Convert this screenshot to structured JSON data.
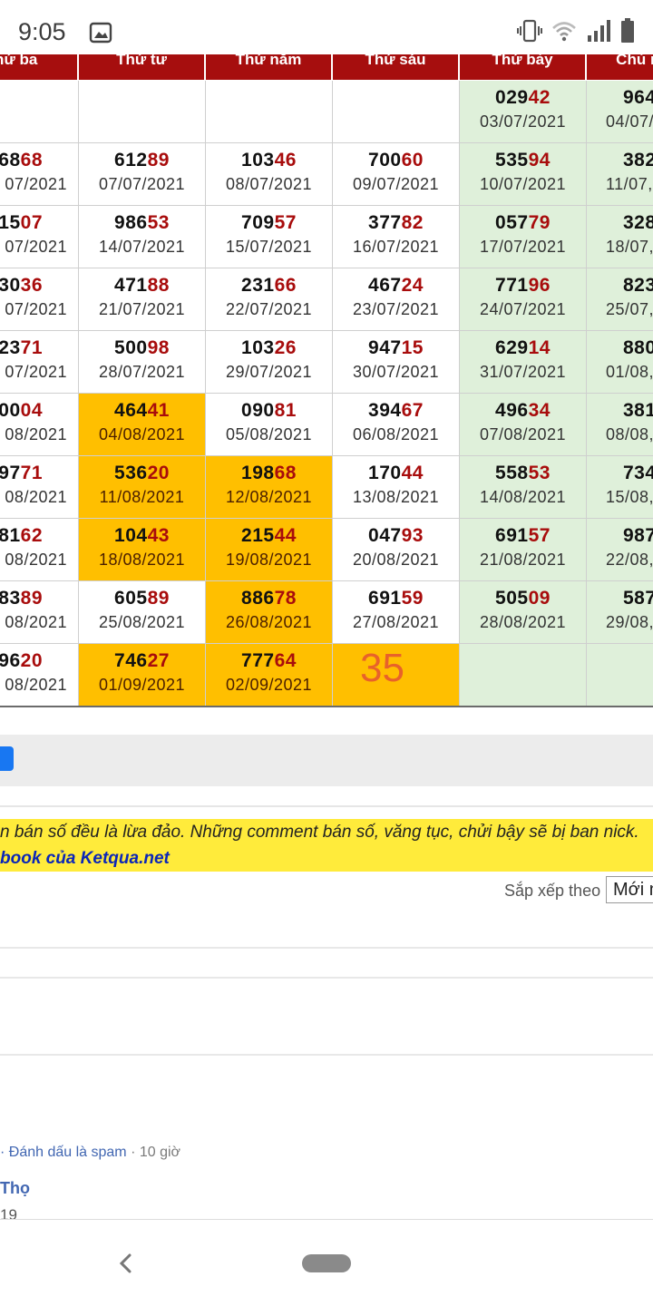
{
  "status": {
    "time": "9:05"
  },
  "table": {
    "headers": [
      "Thứ ba",
      "Thứ tư",
      "Thứ năm",
      "Thứ sáu",
      "Thứ bảy",
      "Chủ nhật"
    ],
    "rows": [
      [
        {
          "head": "",
          "tail": "",
          "date": ""
        },
        {
          "head": "",
          "tail": "",
          "date": ""
        },
        {
          "head": "",
          "tail": "",
          "date": ""
        },
        {
          "head": "",
          "tail": "",
          "date": ""
        },
        {
          "head": "029",
          "tail": "42",
          "date": "03/07/2021"
        },
        {
          "head": "964",
          "tail": "",
          "date": "04/07/"
        }
      ],
      [
        {
          "head": "68",
          "tail": "68",
          "date": "07/2021"
        },
        {
          "head": "612",
          "tail": "89",
          "date": "07/07/2021"
        },
        {
          "head": "103",
          "tail": "46",
          "date": "08/07/2021"
        },
        {
          "head": "700",
          "tail": "60",
          "date": "09/07/2021"
        },
        {
          "head": "535",
          "tail": "94",
          "date": "10/07/2021"
        },
        {
          "head": "382",
          "tail": "",
          "date": "11/07,"
        }
      ],
      [
        {
          "head": "15",
          "tail": "07",
          "date": "07/2021"
        },
        {
          "head": "986",
          "tail": "53",
          "date": "14/07/2021"
        },
        {
          "head": "709",
          "tail": "57",
          "date": "15/07/2021"
        },
        {
          "head": "377",
          "tail": "82",
          "date": "16/07/2021"
        },
        {
          "head": "057",
          "tail": "79",
          "date": "17/07/2021"
        },
        {
          "head": "328",
          "tail": "",
          "date": "18/07,"
        }
      ],
      [
        {
          "head": "30",
          "tail": "36",
          "date": "07/2021"
        },
        {
          "head": "471",
          "tail": "88",
          "date": "21/07/2021"
        },
        {
          "head": "231",
          "tail": "66",
          "date": "22/07/2021"
        },
        {
          "head": "467",
          "tail": "24",
          "date": "23/07/2021"
        },
        {
          "head": "771",
          "tail": "96",
          "date": "24/07/2021"
        },
        {
          "head": "823",
          "tail": "",
          "date": "25/07,"
        }
      ],
      [
        {
          "head": "23",
          "tail": "71",
          "date": "07/2021"
        },
        {
          "head": "500",
          "tail": "98",
          "date": "28/07/2021"
        },
        {
          "head": "103",
          "tail": "26",
          "date": "29/07/2021"
        },
        {
          "head": "947",
          "tail": "15",
          "date": "30/07/2021"
        },
        {
          "head": "629",
          "tail": "14",
          "date": "31/07/2021"
        },
        {
          "head": "880",
          "tail": "",
          "date": "01/08,"
        }
      ],
      [
        {
          "head": "00",
          "tail": "04",
          "date": "08/2021"
        },
        {
          "head": "464",
          "tail": "41",
          "date": "04/08/2021"
        },
        {
          "head": "090",
          "tail": "81",
          "date": "05/08/2021"
        },
        {
          "head": "394",
          "tail": "67",
          "date": "06/08/2021"
        },
        {
          "head": "496",
          "tail": "34",
          "date": "07/08/2021"
        },
        {
          "head": "381",
          "tail": "",
          "date": "08/08,"
        }
      ],
      [
        {
          "head": "97",
          "tail": "71",
          "date": "08/2021"
        },
        {
          "head": "536",
          "tail": "20",
          "date": "11/08/2021"
        },
        {
          "head": "198",
          "tail": "68",
          "date": "12/08/2021"
        },
        {
          "head": "170",
          "tail": "44",
          "date": "13/08/2021"
        },
        {
          "head": "558",
          "tail": "53",
          "date": "14/08/2021"
        },
        {
          "head": "734",
          "tail": "",
          "date": "15/08,"
        }
      ],
      [
        {
          "head": "81",
          "tail": "62",
          "date": "08/2021"
        },
        {
          "head": "104",
          "tail": "43",
          "date": "18/08/2021"
        },
        {
          "head": "215",
          "tail": "44",
          "date": "19/08/2021"
        },
        {
          "head": "047",
          "tail": "93",
          "date": "20/08/2021"
        },
        {
          "head": "691",
          "tail": "57",
          "date": "21/08/2021"
        },
        {
          "head": "987",
          "tail": "",
          "date": "22/08,"
        }
      ],
      [
        {
          "head": "83",
          "tail": "89",
          "date": "08/2021"
        },
        {
          "head": "605",
          "tail": "89",
          "date": "25/08/2021"
        },
        {
          "head": "886",
          "tail": "78",
          "date": "26/08/2021"
        },
        {
          "head": "691",
          "tail": "59",
          "date": "27/08/2021"
        },
        {
          "head": "505",
          "tail": "09",
          "date": "28/08/2021"
        },
        {
          "head": "587",
          "tail": "",
          "date": "29/08,"
        }
      ],
      [
        {
          "head": "96",
          "tail": "20",
          "date": "08/2021"
        },
        {
          "head": "746",
          "tail": "27",
          "date": "01/09/2021"
        },
        {
          "head": "777",
          "tail": "64",
          "date": "02/09/2021"
        },
        {
          "big": "35"
        },
        {
          "head": "",
          "tail": "",
          "date": ""
        },
        {
          "head": "",
          "tail": "",
          "date": ""
        }
      ]
    ],
    "highlight": [
      [
        5,
        1
      ],
      [
        6,
        1
      ],
      [
        6,
        2
      ],
      [
        7,
        1
      ],
      [
        7,
        2
      ],
      [
        8,
        2
      ],
      [
        9,
        1
      ],
      [
        9,
        2
      ],
      [
        9,
        3
      ]
    ]
  },
  "notice": {
    "line1": "n bán số đều là lừa đảo. Những comment bán số, văng tục, chửi bậy sẽ bị ban nick.",
    "line2": "book của Ketqua.net"
  },
  "sort": {
    "label": "Sắp xếp theo",
    "value": "Mới nhất"
  },
  "comment": {
    "spam_link": "· Đánh dấu là spam",
    "time": " · 10 giờ",
    "name": "Thọ",
    "sub": "19"
  },
  "colors": {
    "header": "#a60e0e",
    "highlight": "#ffbf00",
    "weekend": "#dff0da",
    "tail": "#a80c0c"
  }
}
